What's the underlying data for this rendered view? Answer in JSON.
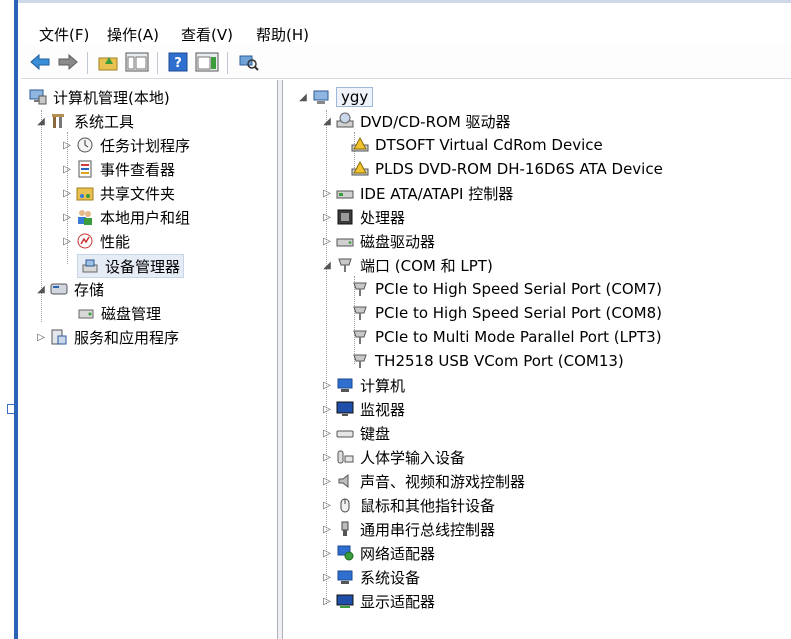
{
  "menu": [
    {
      "label": "文件(F)"
    },
    {
      "label": "操作(A)"
    },
    {
      "label": "查看(V)"
    },
    {
      "label": "帮助(H)"
    }
  ],
  "left_tree": {
    "root": "计算机管理(本地)",
    "system_tools": "系统工具",
    "task_scheduler": "任务计划程序",
    "event_viewer": "事件查看器",
    "shared_folders": "共享文件夹",
    "local_users": "本地用户和组",
    "performance": "性能",
    "device_manager": "设备管理器",
    "storage": "存储",
    "disk_management": "磁盘管理",
    "services_apps": "服务和应用程序"
  },
  "right_tree": {
    "computer": "ygy",
    "dvd": {
      "label": "DVD/CD-ROM 驱动器",
      "children": [
        "DTSOFT Virtual CdRom Device",
        "PLDS DVD-ROM DH-16D6S ATA Device"
      ]
    },
    "ide": "IDE ATA/ATAPI 控制器",
    "processor": "处理器",
    "disk_drives": "磁盘驱动器",
    "ports": {
      "label": "端口 (COM 和 LPT)",
      "children": [
        "PCIe to High Speed Serial Port (COM7)",
        "PCIe to High Speed Serial Port (COM8)",
        "PCIe to Multi Mode Parallel Port (LPT3)",
        "TH2518 USB VCom Port (COM13)"
      ]
    },
    "categories": [
      "计算机",
      "监视器",
      "键盘",
      "人体学输入设备",
      "声音、视频和游戏控制器",
      "鼠标和其他指针设备",
      "通用串行总线控制器",
      "网络适配器",
      "系统设备",
      "显示适配器"
    ]
  },
  "colors": {
    "accent": "#2b63b7",
    "selection": "#e5ecf6"
  }
}
